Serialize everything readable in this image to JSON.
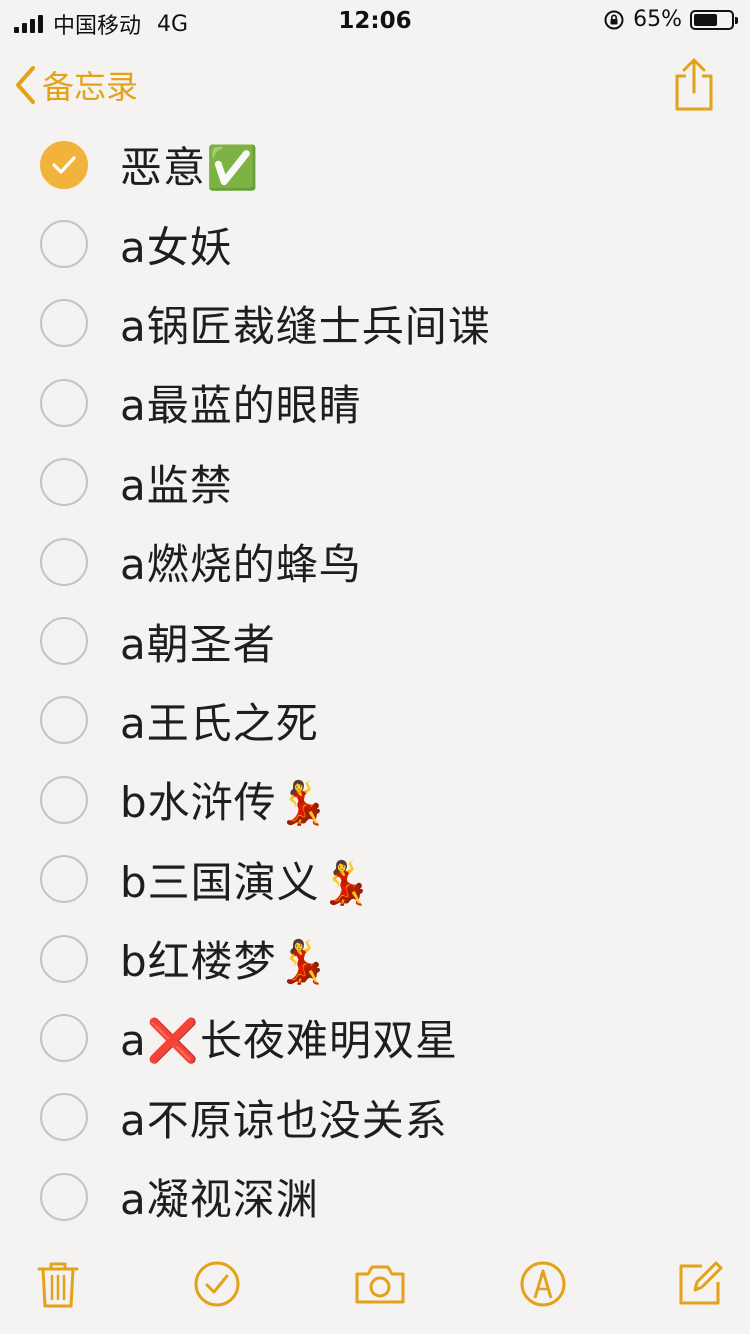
{
  "status_bar": {
    "carrier": "中国移动",
    "network": "4G",
    "time": "12:06",
    "battery_percent": "65%",
    "battery_level": 0.65
  },
  "nav": {
    "back_label": "备忘录"
  },
  "checklist": [
    {
      "text": "恶意✅",
      "checked": true
    },
    {
      "text": "a女妖",
      "checked": false
    },
    {
      "text": "a锅匠裁缝士兵间谍",
      "checked": false
    },
    {
      "text": "a最蓝的眼睛",
      "checked": false
    },
    {
      "text": "a监禁",
      "checked": false
    },
    {
      "text": "a燃烧的蜂鸟",
      "checked": false
    },
    {
      "text": "a朝圣者",
      "checked": false
    },
    {
      "text": "a王氏之死",
      "checked": false
    },
    {
      "text": "b水浒传💃",
      "checked": false
    },
    {
      "text": "b三国演义💃",
      "checked": false
    },
    {
      "text": "b红楼梦💃",
      "checked": false
    },
    {
      "text": "a❌长夜难明双星",
      "checked": false
    },
    {
      "text": "a不原谅也没关系",
      "checked": false
    },
    {
      "text": "a凝视深渊",
      "checked": false
    }
  ],
  "colors": {
    "accent": "#e3a21a",
    "checked_fill": "#f2b33c",
    "unchecked_border": "#c4c4c4",
    "background": "#f4f3f1"
  },
  "icons": {
    "back": "chevron-left-icon",
    "share": "share-icon",
    "trash": "trash-icon",
    "checklist": "checkmark-circle-icon",
    "camera": "camera-icon",
    "markup": "pen-tip-icon",
    "compose": "compose-icon"
  }
}
